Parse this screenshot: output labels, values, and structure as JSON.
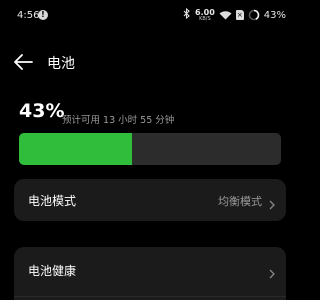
{
  "status_bar": {
    "time": "4:56",
    "notification_badge": "!",
    "network_speed": "6.00",
    "network_speed_unit": "KB/S",
    "sim_indicator": "×",
    "battery_percent": "43%",
    "battery_level": 0.43
  },
  "header": {
    "title": "电池"
  },
  "battery": {
    "percent_label": "43%",
    "estimate": "预计可用 13 小时 55 分钟",
    "level": 0.43,
    "fill_color": "#2fbd3b",
    "track_color": "#2c2c2c"
  },
  "rows": {
    "mode_label": "电池模式",
    "mode_value": "均衡模式",
    "health_label": "电池健康"
  },
  "icons": {
    "back": "arrow-left",
    "chevron": "chevron-right",
    "bluetooth": "bluetooth",
    "wifi": "wifi",
    "battery": "battery-ring"
  }
}
